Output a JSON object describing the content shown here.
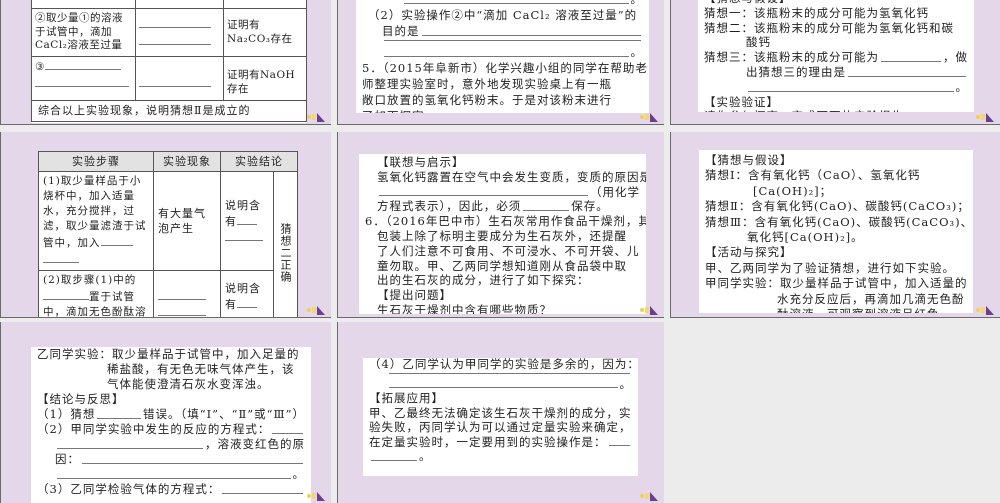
{
  "tile1": {
    "rows": [
      {
        "step": "②取少量①的溶液于试管中，滴加CaCl₂溶液至过量",
        "conclusion": "证明有Na₂CO₃存在"
      },
      {
        "step": "③",
        "conclusion": "证明有NaOH存在"
      }
    ],
    "summary": "综合以上实验现象，说明猜想Ⅱ是成立的"
  },
  "tile2": {
    "lines": [
      [
        null,
        "。"
      ],
      [
        "（2）实验操作②中“滴加 CaCl₂ 溶液至过量”的"
      ],
      [
        "目的是",
        null
      ],
      [
        null
      ],
      [
        null,
        "。"
      ],
      [
        "5．（2015年阜新市）化学兴趣小组的同学在帮助老"
      ],
      [
        "师整理实验室时，意外地发现实验桌上有一瓶"
      ],
      [
        "敞口放置的氢氧化钙粉末。于是对该粉末进行"
      ],
      [
        "了如下探究。"
      ]
    ]
  },
  "tile3": {
    "lines": [
      [
        "【猜想与假设】"
      ],
      [
        "猜想一：该瓶粉末的成分可能为氢氧化钙"
      ],
      [
        "猜想二：该瓶粉末的成分可能为氢氧化钙和碳"
      ],
      [
        "酸钙"
      ],
      [
        "猜想三：该瓶粉末的成分可能为",
        null,
        "，做"
      ],
      [
        "出猜想三的理由是",
        null
      ],
      [
        null,
        "。"
      ],
      [
        "【实验验证】"
      ],
      [
        "请你参与探究，完成下面的实验报告。"
      ]
    ]
  },
  "tile4": {
    "headers": [
      "实验步骤",
      "实验现象",
      "实验结论"
    ],
    "row1": {
      "step": "(1)取少量样品于小烧杯中，加入适量水，充分搅拌，过滤，取少量滤渣于试管中，加入",
      "phenomenon": "有大量气泡产生",
      "conclusion": "说明含有"
    },
    "row2": {
      "step_a": "(2)取步骤(1)中的",
      "step_b": "置于试管中，滴加无色酚酞溶液",
      "conclusion": "说明含有"
    },
    "merged_conclusion": "猜想二正确"
  },
  "tile5": {
    "lines": [
      [
        "【联想与启示】"
      ],
      [
        "氢氧化钙露置在空气中会发生变质，变质的原因是"
      ],
      [
        null,
        "（用化学"
      ],
      [
        "方程式表示），因此，必须",
        null,
        "保存。"
      ],
      [
        "6．（2016年巴中市）生石灰常用作食品干燥剂，其"
      ],
      [
        "包装上除了标明主要成分为生石灰外，还提醒"
      ],
      [
        "了人们注意不可食用、不可浸水、不可开袋、儿"
      ],
      [
        "童勿取。甲、乙两同学想知道刚从食品袋中取"
      ],
      [
        "出的生石灰的成分，进行了如下探究："
      ],
      [
        "【提出问题】"
      ],
      [
        "生石灰干燥剂中含有哪些物质？"
      ]
    ]
  },
  "tile6": {
    "lines": [
      [
        "【猜想与假设】"
      ],
      [
        "猜想Ⅰ：含有氧化钙（CaO）、氢氧化钙"
      ],
      [
        "[Ca(OH)₂]；"
      ],
      [
        "猜想Ⅱ：含有氧化钙(CaO)、碳酸钙(CaCO₃)；"
      ],
      [
        "猜想Ⅲ：含有氧化钙(CaO)、碳酸钙(CaCO₃)、氢"
      ],
      [
        "氧化钙[Ca(OH)₂]。"
      ],
      [
        "【活动与探究】"
      ],
      [
        "甲、乙两同学为了验证猜想，进行如下实验。"
      ],
      [
        "甲同学实验：取少量样品于试管中，加入适量的"
      ],
      [
        "水充分反应后，再滴加几滴无色酚"
      ],
      [
        "酞溶液，可观察到溶液呈红色。"
      ]
    ]
  },
  "tile7": {
    "lines": [
      [
        "乙同学实验：取少量样品于试管中，加入足量的"
      ],
      [
        "稀盐酸，有无色无味气体产生，该"
      ],
      [
        "气体能使澄清石灰水变浑浊。"
      ],
      [
        "【结论与反思】"
      ],
      [
        "（1）猜想",
        null,
        "错误。（填“Ⅰ”、“Ⅱ”或“Ⅲ”）"
      ],
      [
        "（2）甲同学实验中发生的反应的方程式：",
        null
      ],
      [
        null,
        "，溶液变红色的原"
      ],
      [
        "因：",
        null
      ],
      [
        null,
        "。"
      ],
      [
        "（3）乙同学检验气体的方程式：",
        null
      ],
      [
        null,
        "。"
      ]
    ]
  },
  "tile8": {
    "lines": [
      [
        "（4）乙同学认为甲同学的实验是多余的，因为："
      ],
      [
        null
      ],
      [
        null,
        "。"
      ],
      [
        "【拓展应用】"
      ],
      [
        "甲、乙最终无法确定该生石灰干燥剂的成分，实"
      ],
      [
        "验失败，丙同学认为可以通过定量实验来确定，"
      ],
      [
        "在定量实验时，一定要用到的实验操作是：",
        null
      ],
      [
        null,
        "。"
      ]
    ]
  }
}
